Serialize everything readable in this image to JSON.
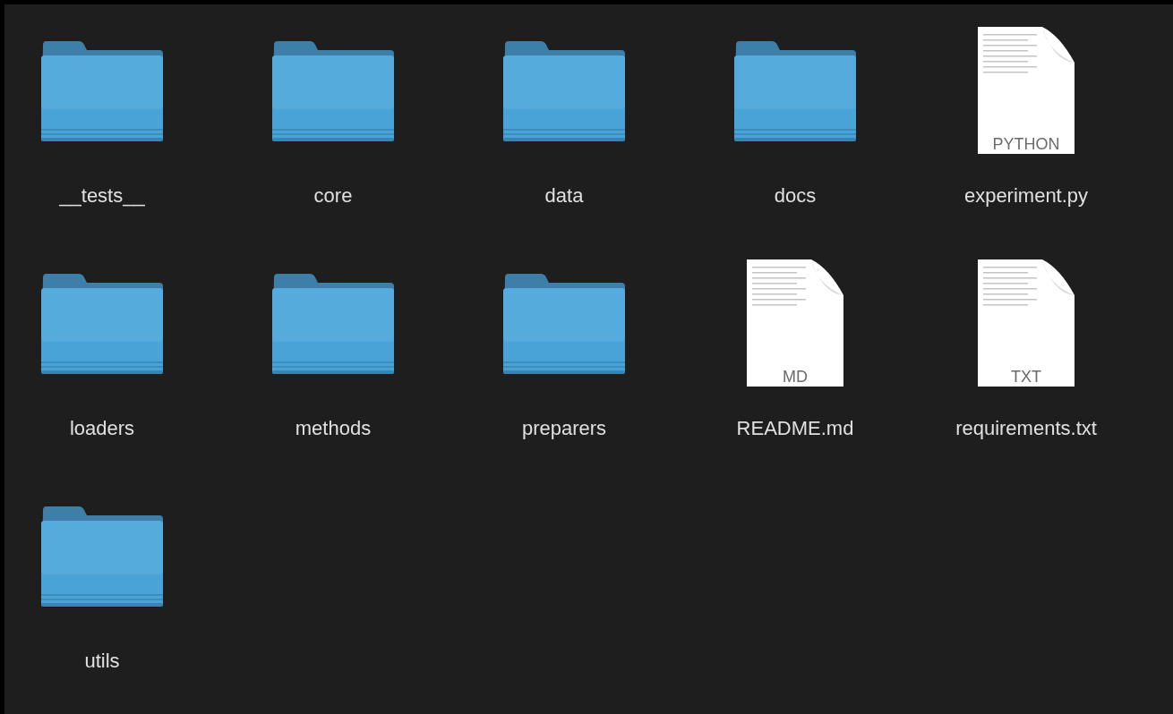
{
  "items": [
    {
      "kind": "folder",
      "name": "__tests__"
    },
    {
      "kind": "folder",
      "name": "core"
    },
    {
      "kind": "folder",
      "name": "data"
    },
    {
      "kind": "folder",
      "name": "docs"
    },
    {
      "kind": "document",
      "name": "experiment.py",
      "type_label": "PYTHON"
    },
    {
      "kind": "folder",
      "name": "loaders"
    },
    {
      "kind": "folder",
      "name": "methods"
    },
    {
      "kind": "folder",
      "name": "preparers"
    },
    {
      "kind": "document",
      "name": "README.md",
      "type_label": "MD"
    },
    {
      "kind": "document",
      "name": "requirements.txt",
      "type_label": "TXT"
    },
    {
      "kind": "folder",
      "name": "utils"
    }
  ]
}
